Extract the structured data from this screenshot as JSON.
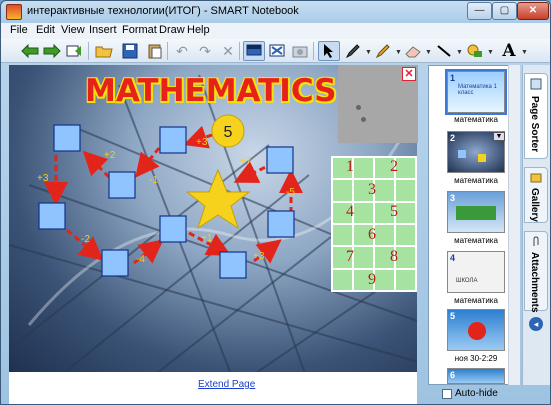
{
  "window": {
    "title": "интерактивные технологии(ИТОГ) - SMART Notebook",
    "min_label": "—",
    "max_label": "▢",
    "close_label": "✕"
  },
  "menu": [
    "File",
    "Edit",
    "View",
    "Insert",
    "Format",
    "Draw",
    "Help"
  ],
  "toolbar": {
    "icons": [
      "previous-page-icon",
      "next-page-icon",
      "add-page-icon",
      "open-file-icon",
      "save-icon",
      "paste-icon",
      "undo-icon",
      "redo-icon",
      "delete-icon",
      "screen-shade-icon",
      "full-screen-icon",
      "capture-icon",
      "select-icon",
      "pen-icon",
      "creative-pen-icon",
      "eraser-icon",
      "line-icon",
      "shape-icon",
      "text-icon"
    ]
  },
  "canvas": {
    "title": "MATHEMATICS",
    "path_start_value": "5",
    "steps": [
      "+3",
      "+2",
      "-1",
      "+3",
      "-2",
      "-4",
      "+1",
      "+3",
      "-5",
      "+7"
    ],
    "number_grid": [
      "1",
      "2",
      "3",
      "4",
      "5",
      "6",
      "7",
      "8",
      "9"
    ],
    "extend_link": "Extend Page"
  },
  "page_sorter": {
    "thumbnails": [
      {
        "num": "1",
        "label": "математика",
        "caption": "Математика 1 класс"
      },
      {
        "num": "2",
        "label": "математика"
      },
      {
        "num": "3",
        "label": "математика"
      },
      {
        "num": "4",
        "label": "математика",
        "caption": "ШКОЛА"
      },
      {
        "num": "5",
        "label": "ноя 30-2:29"
      },
      {
        "num": "6",
        "label": ""
      }
    ],
    "auto_hide_label": "Auto-hide"
  },
  "side_tabs": [
    "Page Sorter",
    "Gallery",
    "Attachments"
  ],
  "colors": {
    "title_red": "#e6221b",
    "title_yellow": "#f8e20a",
    "arrow_red": "#e3241a",
    "box_blue": "#8fc4ff",
    "grid_green": "#a6e3a0",
    "grid_number": "#b31b14",
    "star": "#f7d21d"
  }
}
